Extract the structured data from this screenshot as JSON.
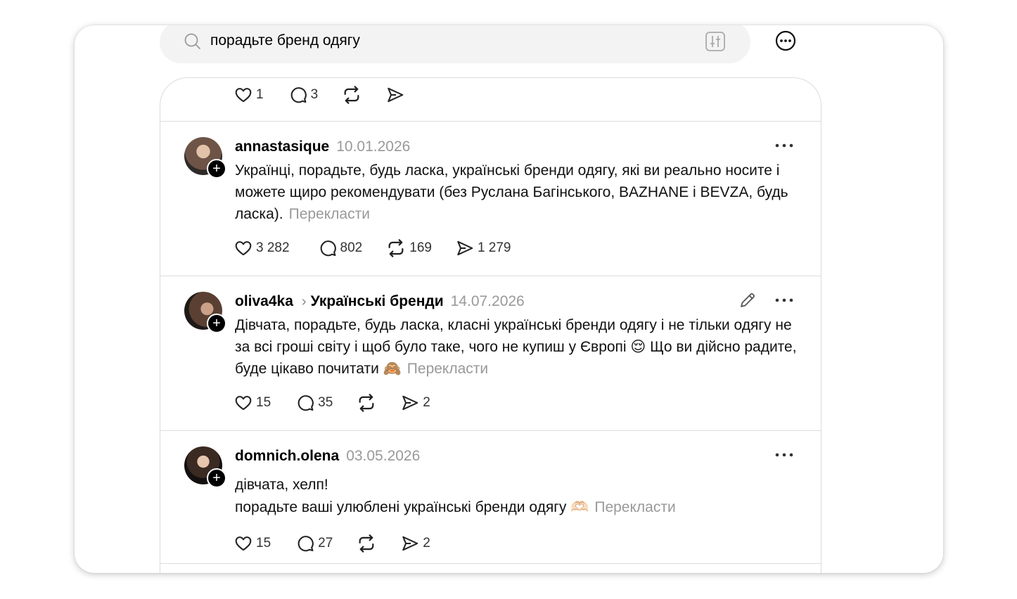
{
  "search": {
    "value": "порадьте бренд одягу"
  },
  "icons": {
    "search": "search-icon",
    "filter": "filter-icon",
    "more": "more-circle-icon",
    "like": "heart-icon",
    "reply": "comment-icon",
    "repost": "repost-icon",
    "share": "share-icon",
    "options": "more-dots-icon",
    "edit": "pencil-icon",
    "follow": "plus-icon"
  },
  "top_post": {
    "likes": "1",
    "replies": "3"
  },
  "posts": [
    {
      "username": "annastasique",
      "date": "10.01.2026",
      "text": "Українці, порадьте, будь ласка, українські бренди одягу, які ви реально носите і можете щиро рекомендувати (без Руслана Багінського, BAZHANE і BEVZA, будь ласка).",
      "translate": "Перекласти",
      "likes": "3 282",
      "replies": "802",
      "reposts": "169",
      "shares": "1 279"
    },
    {
      "username": "oliva4ka",
      "topic": "Українські бренди",
      "date": "14.07.2026",
      "text": "Дівчата, порадьте, будь ласка, класні українські бренди одягу і не тільки одягу не за всі гроші світу і щоб було таке, чого не купиш у Європі 😌 Що ви дійсно радите, буде цікаво почитати 🙈",
      "translate": "Перекласти",
      "likes": "15",
      "replies": "35",
      "shares": "2"
    },
    {
      "username": "domnich.olena",
      "date": "03.05.2026",
      "text_line1": "дівчата, хелп!",
      "text_line2": "порадьте ваші улюблені українські бренди одягу 🫶🏻",
      "translate": "Перекласти",
      "likes": "15",
      "replies": "27",
      "shares": "2"
    }
  ],
  "colors": {
    "muted": "#999999",
    "divider": "#dcdcdc",
    "search_bg": "#f3f3f3"
  },
  "plus_glyph": "+"
}
